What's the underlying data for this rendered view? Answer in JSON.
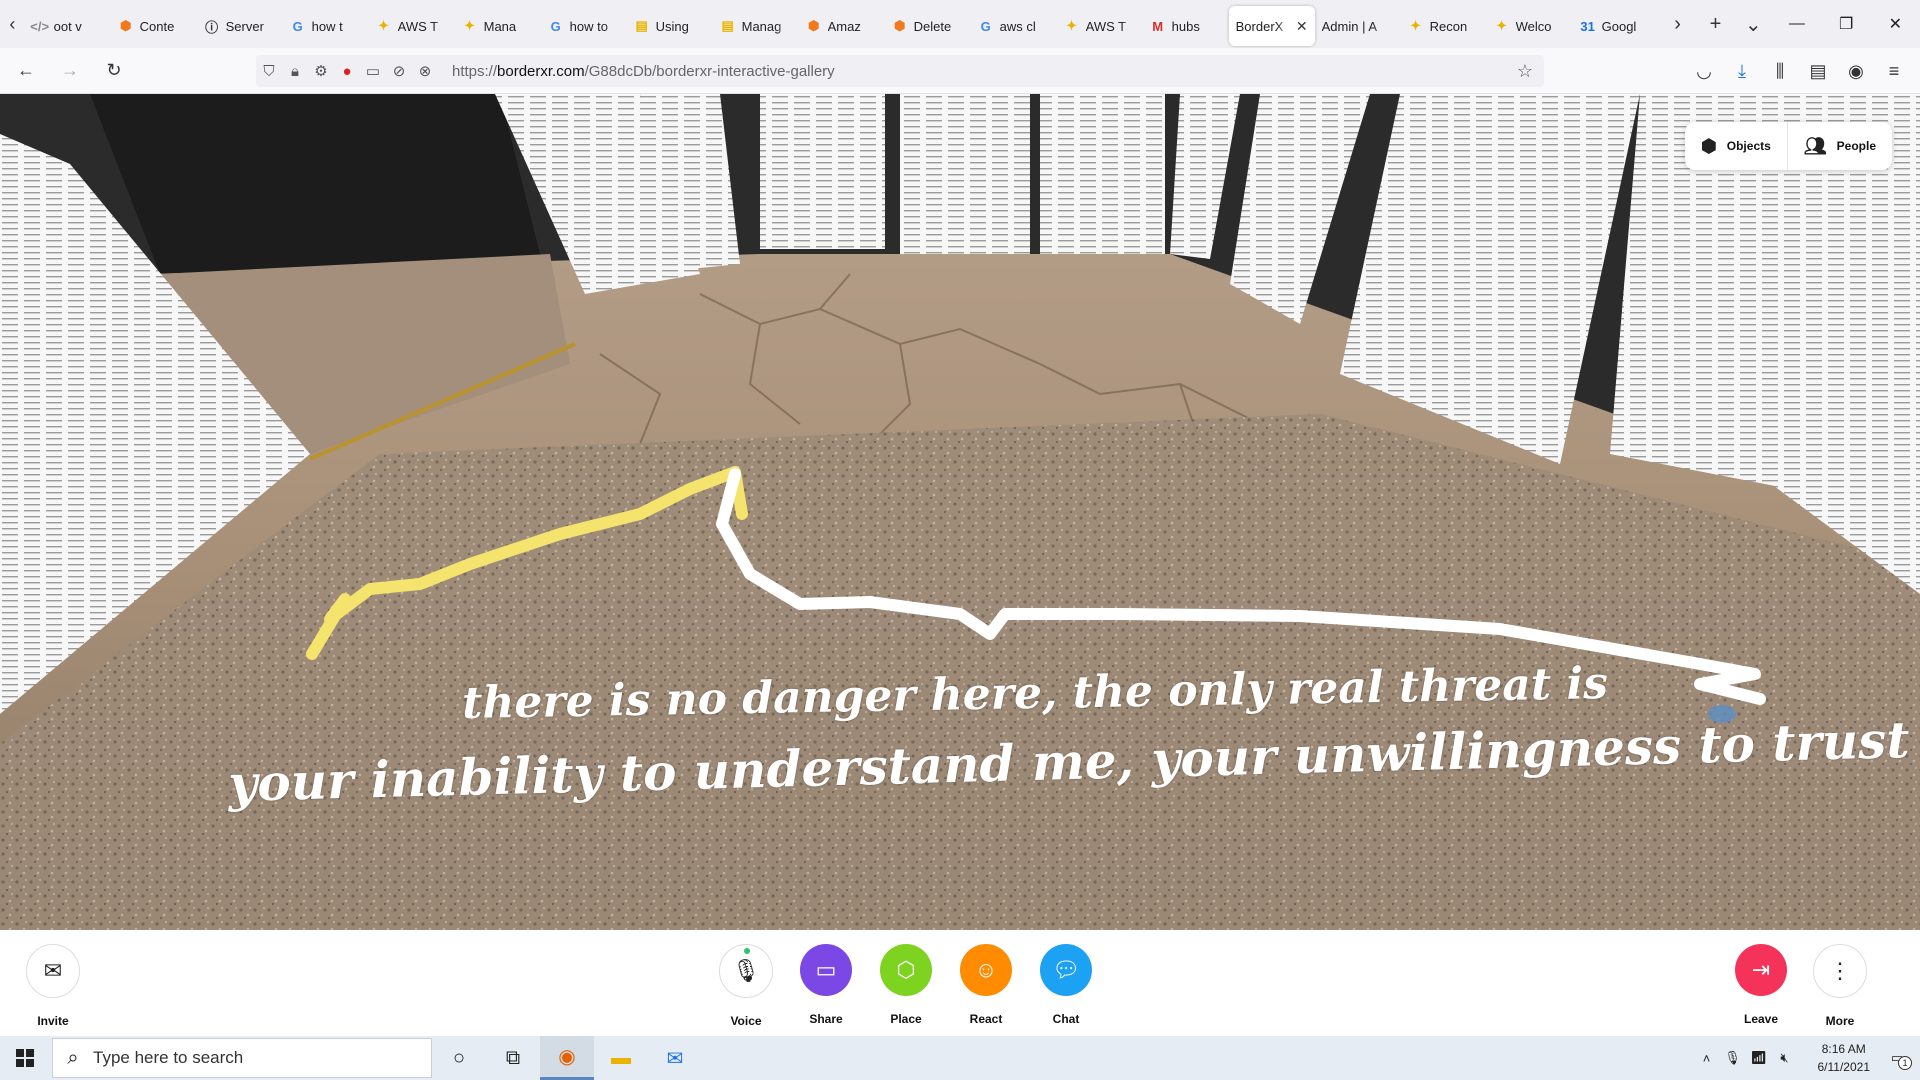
{
  "browser": {
    "tabs": [
      {
        "title": "oot v",
        "icon": "code-icon",
        "color": "#888888"
      },
      {
        "title": "Conte",
        "icon": "aws-cube-icon",
        "color": "#f0781e"
      },
      {
        "title": "Server",
        "icon": "info-icon",
        "color": "#333333"
      },
      {
        "title": "how t",
        "icon": "google-icon",
        "color": "#4285f4"
      },
      {
        "title": "AWS T",
        "icon": "hubs-duck-icon",
        "color": "#e8b400"
      },
      {
        "title": "Mana",
        "icon": "hubs-duck-icon",
        "color": "#e8b400"
      },
      {
        "title": "how to",
        "icon": "google-icon",
        "color": "#4285f4"
      },
      {
        "title": "Using",
        "icon": "docs-icon",
        "color": "#e8b400"
      },
      {
        "title": "Manag",
        "icon": "docs-icon",
        "color": "#e8b400"
      },
      {
        "title": "Amaz",
        "icon": "aws-cube-icon",
        "color": "#f0781e"
      },
      {
        "title": "Delete",
        "icon": "aws-cube-icon",
        "color": "#f0781e"
      },
      {
        "title": "aws cl",
        "icon": "google-icon",
        "color": "#4285f4"
      },
      {
        "title": "AWS T",
        "icon": "hubs-duck-icon",
        "color": "#e8b400"
      },
      {
        "title": "hubs",
        "icon": "gmail-icon",
        "color": "#d93025"
      },
      {
        "title": "BorderX",
        "icon": "none",
        "color": "#ffffff",
        "active": true
      },
      {
        "title": "Admin | A",
        "icon": "none",
        "color": "#ffffff"
      },
      {
        "title": "Recon",
        "icon": "hubs-duck-icon",
        "color": "#e8b400"
      },
      {
        "title": "Welco",
        "icon": "hubs-duck-icon",
        "color": "#e8b400"
      },
      {
        "title": "Googl",
        "icon": "calendar-icon",
        "color": "#1a73e8"
      }
    ],
    "url_prefix": "https://",
    "url_host": "borderxr.com",
    "url_path": "/G88dcDb/borderxr-interactive-gallery"
  },
  "scene": {
    "quote_line1": "there is no danger here, the only real threat is",
    "quote_line2": "your inability to understand me, your unwillingness to trust",
    "objects_label": "Objects",
    "people_label": "People"
  },
  "toolbar": {
    "invite": "Invite",
    "voice": "Voice",
    "share": "Share",
    "place": "Place",
    "react": "React",
    "chat": "Chat",
    "leave": "Leave",
    "more": "More",
    "colors": {
      "share": "#7b47e5",
      "place": "#7ed321",
      "react": "#ff8c00",
      "chat": "#1da1f2",
      "leave": "#f5335a"
    }
  },
  "taskbar": {
    "search_placeholder": "Type here to search",
    "time": "8:16 AM",
    "date": "6/11/2021",
    "notification_count": "1"
  }
}
